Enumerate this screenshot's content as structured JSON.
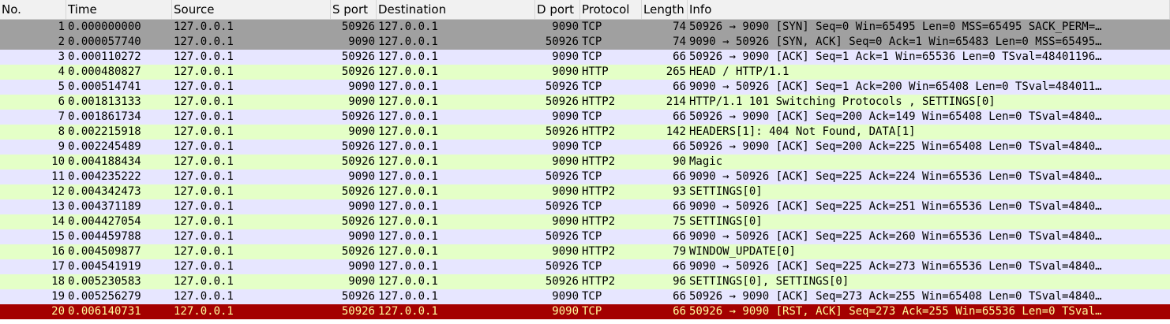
{
  "columns": {
    "no": "No.",
    "time": "Time",
    "source": "Source",
    "sport": "S port",
    "destination": "Destination",
    "dport": "D port",
    "protocol": "Protocol",
    "length": "Length",
    "info": "Info"
  },
  "packets": [
    {
      "no": "1",
      "time": "0.000000000",
      "source": "127.0.0.1",
      "sport": "50926",
      "destination": "127.0.0.1",
      "dport": "9090",
      "protocol": "TCP",
      "length": "74",
      "info": "50926 → 9090 [SYN] Seq=0 Win=65495 Len=0 MSS=65495 SACK_PERM=…",
      "style": "sel-gray"
    },
    {
      "no": "2",
      "time": "0.000057740",
      "source": "127.0.0.1",
      "sport": "9090",
      "destination": "127.0.0.1",
      "dport": "50926",
      "protocol": "TCP",
      "length": "74",
      "info": "9090 → 50926 [SYN, ACK] Seq=0 Ack=1 Win=65483 Len=0 MSS=65495…",
      "style": "sel-gray"
    },
    {
      "no": "3",
      "time": "0.000110272",
      "source": "127.0.0.1",
      "sport": "50926",
      "destination": "127.0.0.1",
      "dport": "9090",
      "protocol": "TCP",
      "length": "66",
      "info": "50926 → 9090 [ACK] Seq=1 Ack=1 Win=65536 Len=0 TSval=48401196…",
      "style": "tcp"
    },
    {
      "no": "4",
      "time": "0.000480827",
      "source": "127.0.0.1",
      "sport": "50926",
      "destination": "127.0.0.1",
      "dport": "9090",
      "protocol": "HTTP",
      "length": "265",
      "info": "HEAD / HTTP/1.1",
      "style": "http"
    },
    {
      "no": "5",
      "time": "0.000514741",
      "source": "127.0.0.1",
      "sport": "9090",
      "destination": "127.0.0.1",
      "dport": "50926",
      "protocol": "TCP",
      "length": "66",
      "info": "9090 → 50926 [ACK] Seq=1 Ack=200 Win=65408 Len=0 TSval=484011…",
      "style": "tcp"
    },
    {
      "no": "6",
      "time": "0.001813133",
      "source": "127.0.0.1",
      "sport": "9090",
      "destination": "127.0.0.1",
      "dport": "50926",
      "protocol": "HTTP2",
      "length": "214",
      "info": "HTTP/1.1 101 Switching Protocols , SETTINGS[0]",
      "style": "http"
    },
    {
      "no": "7",
      "time": "0.001861734",
      "source": "127.0.0.1",
      "sport": "50926",
      "destination": "127.0.0.1",
      "dport": "9090",
      "protocol": "TCP",
      "length": "66",
      "info": "50926 → 9090 [ACK] Seq=200 Ack=149 Win=65408 Len=0 TSval=4840…",
      "style": "tcp"
    },
    {
      "no": "8",
      "time": "0.002215918",
      "source": "127.0.0.1",
      "sport": "9090",
      "destination": "127.0.0.1",
      "dport": "50926",
      "protocol": "HTTP2",
      "length": "142",
      "info": "HEADERS[1]: 404 Not Found, DATA[1]",
      "style": "http"
    },
    {
      "no": "9",
      "time": "0.002245489",
      "source": "127.0.0.1",
      "sport": "50926",
      "destination": "127.0.0.1",
      "dport": "9090",
      "protocol": "TCP",
      "length": "66",
      "info": "50926 → 9090 [ACK] Seq=200 Ack=225 Win=65408 Len=0 TSval=4840…",
      "style": "tcp"
    },
    {
      "no": "10",
      "time": "0.004188434",
      "source": "127.0.0.1",
      "sport": "50926",
      "destination": "127.0.0.1",
      "dport": "9090",
      "protocol": "HTTP2",
      "length": "90",
      "info": "Magic",
      "style": "http"
    },
    {
      "no": "11",
      "time": "0.004235222",
      "source": "127.0.0.1",
      "sport": "9090",
      "destination": "127.0.0.1",
      "dport": "50926",
      "protocol": "TCP",
      "length": "66",
      "info": "9090 → 50926 [ACK] Seq=225 Ack=224 Win=65536 Len=0 TSval=4840…",
      "style": "tcp"
    },
    {
      "no": "12",
      "time": "0.004342473",
      "source": "127.0.0.1",
      "sport": "50926",
      "destination": "127.0.0.1",
      "dport": "9090",
      "protocol": "HTTP2",
      "length": "93",
      "info": "SETTINGS[0]",
      "style": "http"
    },
    {
      "no": "13",
      "time": "0.004371189",
      "source": "127.0.0.1",
      "sport": "9090",
      "destination": "127.0.0.1",
      "dport": "50926",
      "protocol": "TCP",
      "length": "66",
      "info": "9090 → 50926 [ACK] Seq=225 Ack=251 Win=65536 Len=0 TSval=4840…",
      "style": "tcp"
    },
    {
      "no": "14",
      "time": "0.004427054",
      "source": "127.0.0.1",
      "sport": "50926",
      "destination": "127.0.0.1",
      "dport": "9090",
      "protocol": "HTTP2",
      "length": "75",
      "info": "SETTINGS[0]",
      "style": "http"
    },
    {
      "no": "15",
      "time": "0.004459788",
      "source": "127.0.0.1",
      "sport": "9090",
      "destination": "127.0.0.1",
      "dport": "50926",
      "protocol": "TCP",
      "length": "66",
      "info": "9090 → 50926 [ACK] Seq=225 Ack=260 Win=65536 Len=0 TSval=4840…",
      "style": "tcp"
    },
    {
      "no": "16",
      "time": "0.004509877",
      "source": "127.0.0.1",
      "sport": "50926",
      "destination": "127.0.0.1",
      "dport": "9090",
      "protocol": "HTTP2",
      "length": "79",
      "info": "WINDOW_UPDATE[0]",
      "style": "http"
    },
    {
      "no": "17",
      "time": "0.004541919",
      "source": "127.0.0.1",
      "sport": "9090",
      "destination": "127.0.0.1",
      "dport": "50926",
      "protocol": "TCP",
      "length": "66",
      "info": "9090 → 50926 [ACK] Seq=225 Ack=273 Win=65536 Len=0 TSval=4840…",
      "style": "tcp"
    },
    {
      "no": "18",
      "time": "0.005230583",
      "source": "127.0.0.1",
      "sport": "9090",
      "destination": "127.0.0.1",
      "dport": "50926",
      "protocol": "HTTP2",
      "length": "96",
      "info": "SETTINGS[0], SETTINGS[0]",
      "style": "http"
    },
    {
      "no": "19",
      "time": "0.005256279",
      "source": "127.0.0.1",
      "sport": "50926",
      "destination": "127.0.0.1",
      "dport": "9090",
      "protocol": "TCP",
      "length": "66",
      "info": "50926 → 9090 [ACK] Seq=273 Ack=255 Win=65408 Len=0 TSval=4840…",
      "style": "tcp"
    },
    {
      "no": "20",
      "time": "0.006140731",
      "source": "127.0.0.1",
      "sport": "50926",
      "destination": "127.0.0.1",
      "dport": "9090",
      "protocol": "TCP",
      "length": "66",
      "info": "50926 → 9090 [RST, ACK] Seq=273 Ack=255 Win=65536 Len=0 TSval…",
      "style": "rst"
    }
  ],
  "colors": {
    "tcp_row": "#e7e6ff",
    "http_row": "#e4ffc7",
    "marked_row": "#a0a0a0",
    "rst_row_bg": "#a40000",
    "rst_row_fg": "#fffc9c",
    "header_bg": "#f1f1f1"
  }
}
